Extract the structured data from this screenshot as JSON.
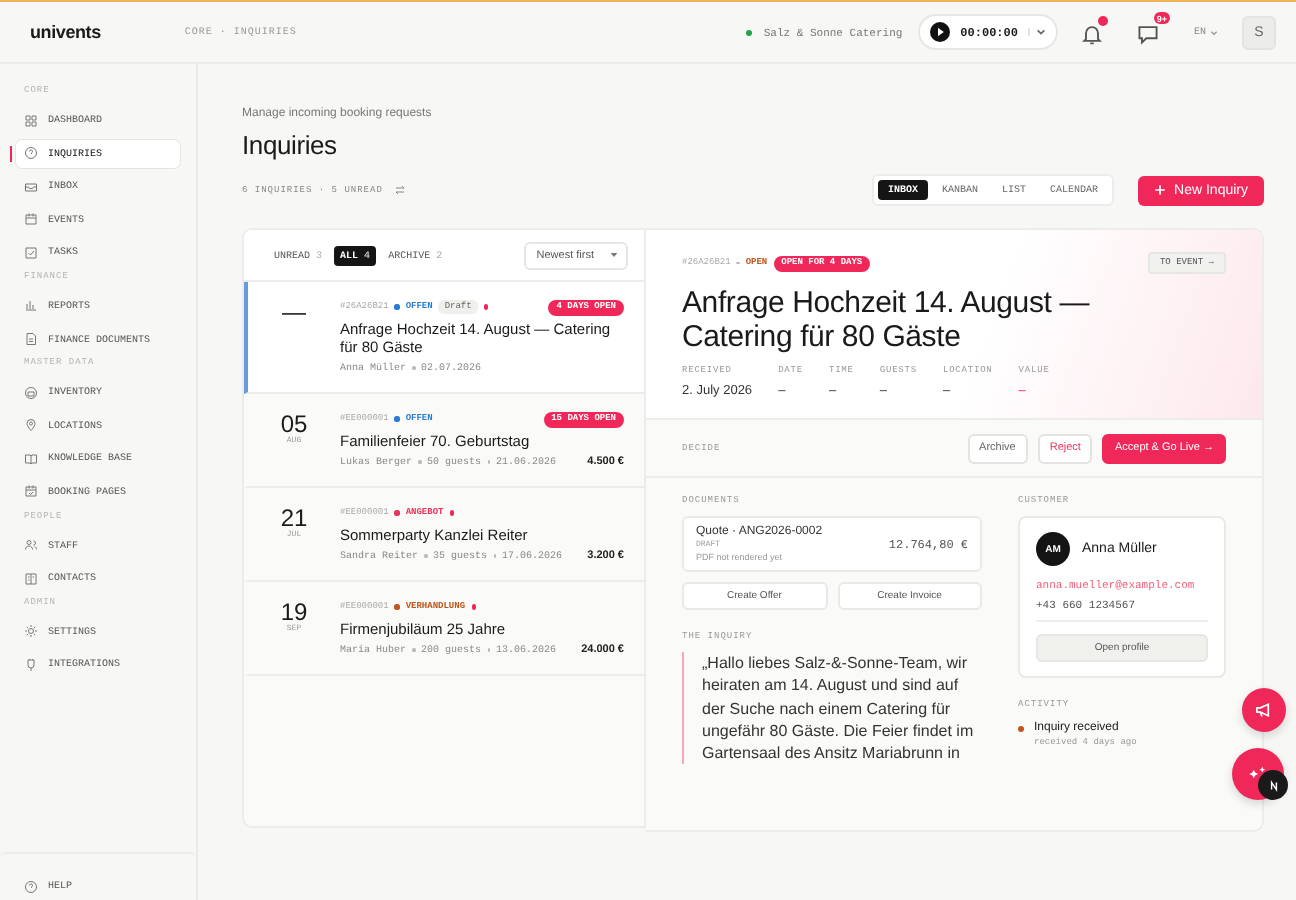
{
  "header": {
    "logo": "univents",
    "breadcrumb": "CORE · INQUIRIES",
    "workspace": {
      "name": "Salz & Sonne Catering",
      "color": "#22a34a"
    },
    "timer": "00:00:00",
    "messages_badge": "9+",
    "language": "EN",
    "avatar": "S"
  },
  "sidebar": {
    "sections": [
      {
        "label": "CORE",
        "items": [
          {
            "label": "DASHBOARD",
            "selected": false
          },
          {
            "label": "INQUIRIES",
            "selected": true
          },
          {
            "label": "INBOX",
            "selected": false
          },
          {
            "label": "EVENTS",
            "selected": false
          },
          {
            "label": "TASKS",
            "selected": false
          }
        ]
      },
      {
        "label": "FINANCE",
        "items": [
          {
            "label": "REPORTS",
            "selected": false
          },
          {
            "label": "FINANCE DOCUMENTS",
            "selected": false
          }
        ]
      },
      {
        "label": "MASTER DATA",
        "items": [
          {
            "label": "INVENTORY",
            "selected": false
          },
          {
            "label": "LOCATIONS",
            "selected": false
          },
          {
            "label": "KNOWLEDGE BASE",
            "selected": false
          },
          {
            "label": "BOOKING PAGES",
            "selected": false
          }
        ]
      },
      {
        "label": "PEOPLE",
        "items": [
          {
            "label": "STAFF",
            "selected": false
          },
          {
            "label": "CONTACTS",
            "selected": false
          }
        ]
      },
      {
        "label": "ADMIN",
        "items": [
          {
            "label": "SETTINGS",
            "selected": false
          },
          {
            "label": "INTEGRATIONS",
            "selected": false
          }
        ]
      }
    ],
    "footer": "HELP"
  },
  "page": {
    "subtitle": "Manage incoming booking requests",
    "title": "Inquiries",
    "summary": "6 INQUIRIES · 5 UNREAD",
    "views": [
      {
        "label": "INBOX",
        "selected": true
      },
      {
        "label": "KANBAN",
        "selected": false
      },
      {
        "label": "LIST",
        "selected": false
      },
      {
        "label": "CALENDAR",
        "selected": false
      }
    ],
    "new_button": "New Inquiry"
  },
  "list": {
    "filters": [
      {
        "label": "UNREAD",
        "count": "3",
        "selected": false
      },
      {
        "label": "ALL",
        "count": "4",
        "selected": true
      },
      {
        "label": "ARCHIVE",
        "count": "2",
        "selected": false
      }
    ],
    "sort": "Newest first",
    "rows": [
      {
        "day": "—",
        "id": "#26A26B21",
        "status": "OFFEN",
        "color": "#2b7bd6",
        "tag": "Draft",
        "unread": true,
        "badge": "4 DAYS OPEN",
        "title": "Anfrage Hochzeit 14. August — Catering für 80 Gäste",
        "meta": [
          "Anna Müller",
          "02.07.2026"
        ],
        "selected": true
      },
      {
        "day": "05",
        "month": "AUG",
        "id": "#EE000001",
        "status": "OFFEN",
        "color": "#2b7bd6",
        "unread": false,
        "badge": "15 DAYS OPEN",
        "title": "Familienfeier 70. Geburtstag",
        "meta": [
          "Lukas Berger",
          "50 guests",
          "21.06.2026"
        ],
        "amount": "4.500 €",
        "selected": false
      },
      {
        "day": "21",
        "month": "JUL",
        "id": "#EE000001",
        "status": "ANGEBOT",
        "color": "#e8335a",
        "unread": true,
        "title": "Sommerparty Kanzlei Reiter",
        "meta": [
          "Sandra Reiter",
          "35 guests",
          "17.06.2026"
        ],
        "amount": "3.200 €",
        "selected": false
      },
      {
        "day": "19",
        "month": "SEP",
        "id": "#EE000001",
        "status": "VERHANDLUNG",
        "color": "#c0561b",
        "unread": true,
        "title": "Firmenjubiläum 25 Jahre",
        "meta": [
          "Maria Huber",
          "200 guests",
          "13.06.2026"
        ],
        "amount": "24.000 €",
        "selected": false
      }
    ]
  },
  "detail": {
    "id": "#26A26B21",
    "status": "OPEN",
    "badge": "OPEN FOR 4 DAYS",
    "to_event": "TO EVENT →",
    "title": "Anfrage Hochzeit 14. August — Catering für 80 Gäste",
    "facts": [
      {
        "label": "RECEIVED",
        "value": "2. July 2026",
        "accent": false
      },
      {
        "label": "DATE",
        "value": "–",
        "accent": false
      },
      {
        "label": "TIME",
        "value": "–",
        "accent": false
      },
      {
        "label": "GUESTS",
        "value": "–",
        "accent": false
      },
      {
        "label": "LOCATION",
        "value": "–",
        "accent": false
      },
      {
        "label": "VALUE",
        "value": "–",
        "accent": true
      }
    ],
    "decide": {
      "label": "DECIDE",
      "buttons": [
        {
          "label": "Archive",
          "kind": "ghost"
        },
        {
          "label": "Reject",
          "kind": "danger"
        },
        {
          "label": "Accept & Go Live →",
          "kind": "primary"
        }
      ]
    },
    "documents": {
      "label": "DOCUMENTS",
      "doc": {
        "title": "Quote · ANG2026-0002",
        "status": "DRAFT",
        "note": "PDF not rendered yet",
        "amount": "12.764,80 €"
      },
      "buttons": [
        "Create Offer",
        "Create Invoice"
      ]
    },
    "inquiry": {
      "label": "THE INQUIRY",
      "text": "„Hallo liebes Salz-&-Sonne-Team, wir heiraten am 14. August und sind auf der Suche nach einem Catering für ungefähr 80 Gäste. Die Feier findet im Gartensaal des Ansitz Mariabrunn in"
    },
    "customer": {
      "label": "CUSTOMER",
      "initials": "AM",
      "name": "Anna Müller",
      "email": "anna.mueller@example.com",
      "phone": "+43 660 1234567",
      "button": "Open profile"
    },
    "activity": {
      "label": "ACTIVITY",
      "items": [
        {
          "title": "Inquiry received",
          "time": "received 4 days ago",
          "color": "#c0561b"
        }
      ]
    }
  }
}
